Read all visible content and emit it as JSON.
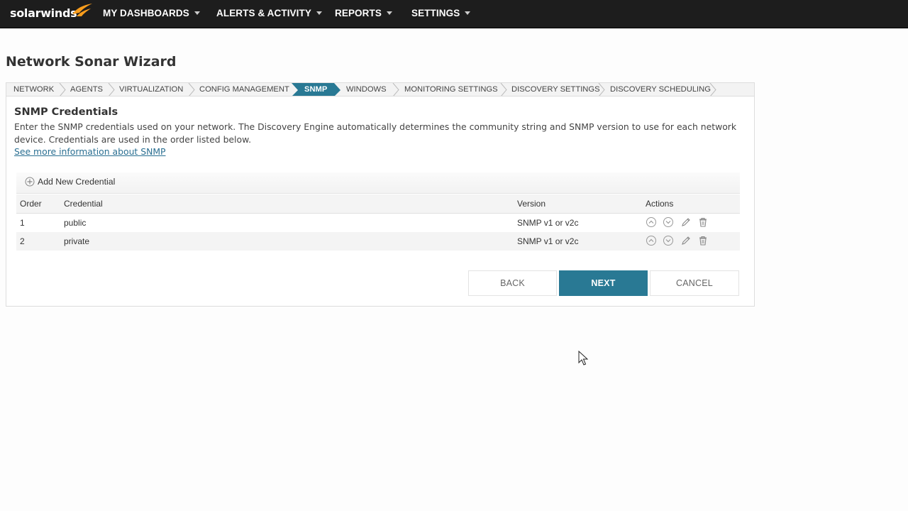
{
  "brand": {
    "logo_text": "solarwinds"
  },
  "nav": {
    "items": [
      {
        "label": "MY DASHBOARDS"
      },
      {
        "label": "ALERTS & ACTIVITY"
      },
      {
        "label": "REPORTS"
      },
      {
        "label": "SETTINGS"
      }
    ]
  },
  "page": {
    "title": "Network Sonar Wizard"
  },
  "wizard": {
    "steps": [
      {
        "label": "NETWORK"
      },
      {
        "label": "AGENTS"
      },
      {
        "label": "VIRTUALIZATION"
      },
      {
        "label": "CONFIG MANAGEMENT"
      },
      {
        "label": "SNMP",
        "active": true
      },
      {
        "label": "WINDOWS"
      },
      {
        "label": "MONITORING SETTINGS"
      },
      {
        "label": "DISCOVERY SETTINGS"
      },
      {
        "label": "DISCOVERY SCHEDULING"
      }
    ]
  },
  "snmp": {
    "title": "SNMP Credentials",
    "description": "Enter the SNMP credentials used on your network. The Discovery Engine automatically determines the community string and SNMP version to use for each network device. Credentials are used in the order listed below.",
    "more_link": "See more information about SNMP",
    "add_label": "Add New Credential",
    "columns": {
      "order": "Order",
      "credential": "Credential",
      "version": "Version",
      "actions": "Actions"
    },
    "rows": [
      {
        "order": "1",
        "credential": "public",
        "version": "SNMP v1 or v2c"
      },
      {
        "order": "2",
        "credential": "private",
        "version": "SNMP v1 or v2c"
      }
    ]
  },
  "buttons": {
    "back": "BACK",
    "next": "NEXT",
    "cancel": "CANCEL"
  },
  "colors": {
    "accent": "#297994",
    "topbar": "#1d1d1d",
    "logo_flame": "#f99d1c",
    "link": "#2a6f92"
  }
}
